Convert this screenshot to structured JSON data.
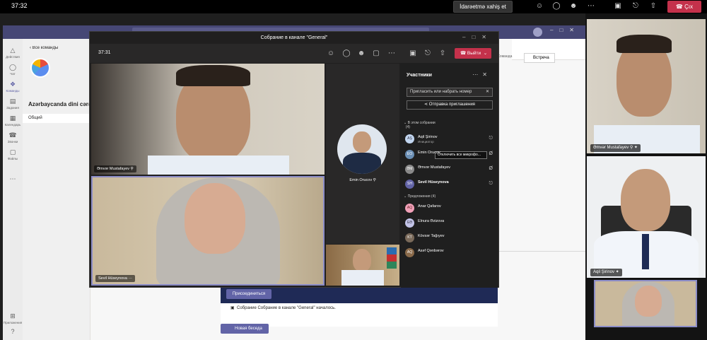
{
  "share_bar": {
    "time": "37:32",
    "request_control": "İdarəetmə xahiş et",
    "exit_label": "Çıx"
  },
  "teams": {
    "rail": [
      {
        "icon": "bell-icon",
        "label": "Действия"
      },
      {
        "icon": "chat-icon",
        "label": "Чат"
      },
      {
        "icon": "teams-icon",
        "label": "Команды"
      },
      {
        "icon": "assignments-icon",
        "label": "Задания"
      },
      {
        "icon": "calendar-icon",
        "label": "Календарь"
      },
      {
        "icon": "calls-icon",
        "label": "Звонки"
      },
      {
        "icon": "files-icon",
        "label": "Файлы"
      }
    ],
    "rail_bottom": [
      {
        "icon": "apps-icon",
        "label": "Приложения"
      }
    ],
    "back_link": "Все команды",
    "team_name": "Azərbaycanda dini cərə",
    "channel": "Общий",
    "team_chip": "Команда",
    "meet_button": "Встреча",
    "join_button": "Присоединиться",
    "meeting_started": "Собрание Собрание в канале \"General\" началось.",
    "new_post_button": "Новая беседа"
  },
  "meeting": {
    "title": "Собрание в канале \"General\"",
    "timer": "37:31",
    "leave_label": "Выйти",
    "tiles": [
      {
        "name": "Əmvər Mustafayev"
      },
      {
        "name": "Sevil Hüseynova"
      },
      {
        "name": "Emin Orucov"
      }
    ],
    "participants": {
      "title": "Участники",
      "invite_placeholder": "Пригласить или набрать номер",
      "share_invite": "Отправка приглашения",
      "in_meeting_header": "В этом собрании",
      "in_meeting_count": "(4)",
      "mute_all_tip": "Отключить все микрофо...",
      "in_meeting": [
        {
          "initials": "AŞ",
          "name": "Aqil Şirinov",
          "role": "Инициатор",
          "color": "#c2d6f0"
        },
        {
          "initials": "EO",
          "name": "Emin Orucov",
          "role": "",
          "color": "#6b8fb5"
        },
        {
          "initials": "ƏM",
          "name": "Əmvər Mustafayev",
          "role": "",
          "color": "#8a8a8a"
        },
        {
          "initials": "SH",
          "name": "Sevil Hüseynova",
          "role": "",
          "color": "#6264a7"
        }
      ],
      "suggested_header": "Предложения (4)",
      "suggested": [
        {
          "initials": "AQ",
          "name": "Anar Qafarov",
          "color": "#f1a0b8"
        },
        {
          "initials": "EƏ",
          "name": "Elnura Əzizova",
          "color": "#c3c4e8"
        },
        {
          "initials": "KT",
          "name": "Kövsər Tağıyev",
          "color": "#7a6a5a"
        },
        {
          "initials": "AQ",
          "name": "Asəf Qənbərov",
          "color": "#8a6a4a"
        }
      ]
    }
  },
  "right_column": [
    {
      "name": "Əmvər Mustafayev"
    },
    {
      "name": "Aqil Şirinov"
    }
  ],
  "colors": {
    "accent": "#6264a7",
    "leave": "#c4314b",
    "title_bar": "#464775"
  }
}
